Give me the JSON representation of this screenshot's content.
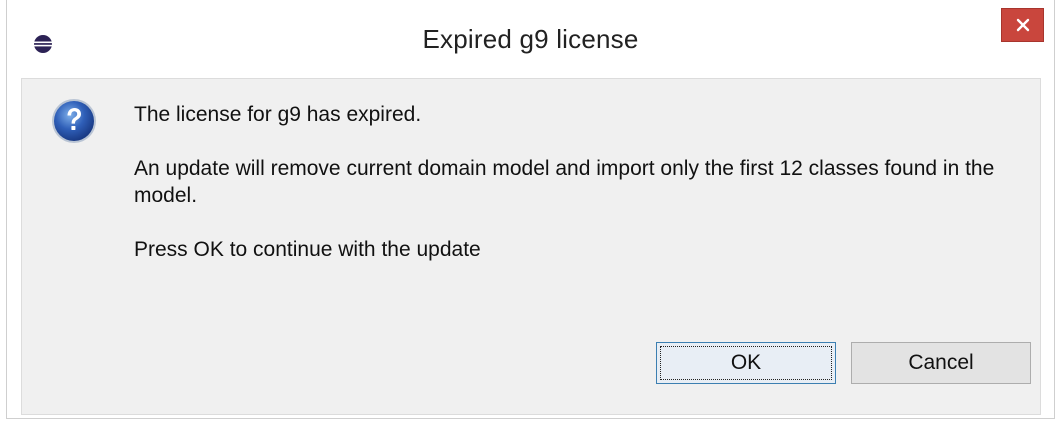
{
  "window": {
    "title": "Expired g9 license",
    "app_icon": "eclipse-icon",
    "close_icon": "close-icon",
    "close_color": "#c9463d"
  },
  "dialog": {
    "icon": "question-icon",
    "messages": [
      "The license for g9 has expired.",
      "An update will remove current domain model and import only the first 12 classes found in the model.",
      "Press OK to continue with the update"
    ]
  },
  "buttons": {
    "ok_label": "OK",
    "cancel_label": "Cancel"
  }
}
